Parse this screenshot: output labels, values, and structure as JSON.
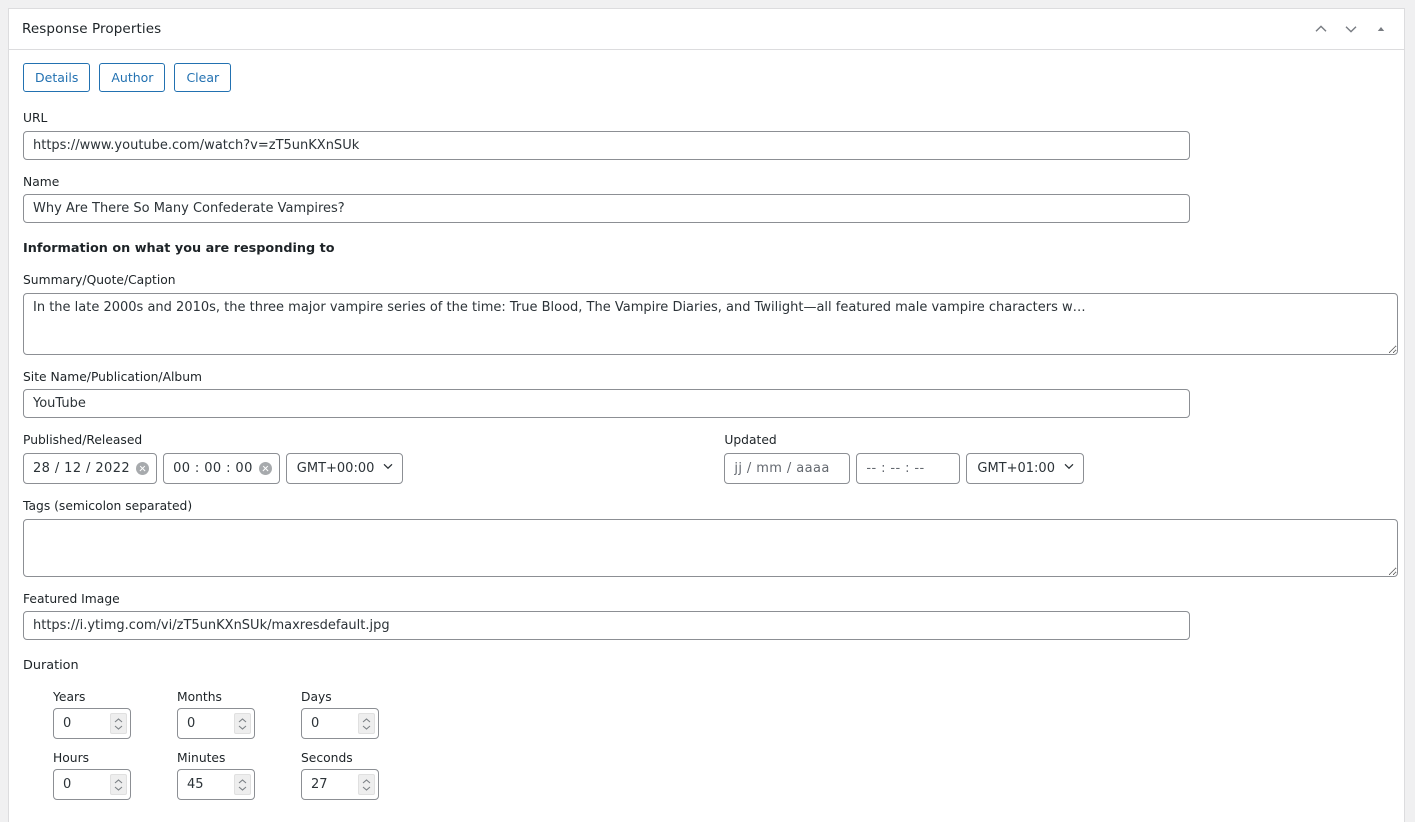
{
  "panel": {
    "title": "Response Properties",
    "header_icons": [
      {
        "name": "chevron-up-icon",
        "glyph": "chevron-up"
      },
      {
        "name": "chevron-down-icon",
        "glyph": "chevron-down"
      },
      {
        "name": "collapse-triangle-icon",
        "glyph": "triangle-up"
      }
    ]
  },
  "toolbar": {
    "buttons": [
      {
        "label": "Details",
        "name": "details-button"
      },
      {
        "label": "Author",
        "name": "author-button"
      },
      {
        "label": "Clear",
        "name": "clear-button"
      }
    ]
  },
  "fields": {
    "url": {
      "label": "URL",
      "value": "https://www.youtube.com/watch?v=zT5unKXnSUk",
      "placeholder": ""
    },
    "name": {
      "label": "Name",
      "value": "Why Are There So Many Confederate Vampires?",
      "placeholder": ""
    },
    "responding_heading": "Information on what you are responding to",
    "summary": {
      "label": "Summary/Quote/Caption",
      "value": "In the late 2000s and 2010s, the three major vampire series of the time: True Blood, The Vampire Diaries, and Twilight—all featured male vampire characters w…",
      "placeholder": ""
    },
    "site_name": {
      "label": "Site Name/Publication/Album",
      "value": "YouTube",
      "placeholder": ""
    },
    "published": {
      "label": "Published/Released",
      "date_value": "28 / 12 / 2022",
      "time_value": "00 : 00 : 00",
      "timezone": "GMT+00:00",
      "date_is_placeholder": false,
      "time_is_placeholder": false
    },
    "updated": {
      "label": "Updated",
      "date_value": "jj / mm / aaaa",
      "time_value": "-- : -- : --",
      "timezone": "GMT+01:00",
      "date_is_placeholder": true,
      "time_is_placeholder": true
    },
    "tags": {
      "label": "Tags (semicolon separated)",
      "value": "",
      "placeholder": ""
    },
    "featured_image": {
      "label": "Featured Image",
      "value": "https://i.ytimg.com/vi/zT5unKXnSUk/maxresdefault.jpg",
      "placeholder": ""
    }
  },
  "duration": {
    "heading": "Duration",
    "row1": [
      {
        "label": "Years",
        "value": "0"
      },
      {
        "label": "Months",
        "value": "0"
      },
      {
        "label": "Days",
        "value": "0"
      }
    ],
    "row2": [
      {
        "label": "Hours",
        "value": "0"
      },
      {
        "label": "Minutes",
        "value": "45"
      },
      {
        "label": "Seconds",
        "value": "27"
      }
    ]
  },
  "colors": {
    "accent_blue": "#2271b1",
    "border_gray": "#8c8f94",
    "panel_border": "#dcdcde",
    "text_dark": "#1d2327",
    "page_background": "#f0f0f1"
  }
}
